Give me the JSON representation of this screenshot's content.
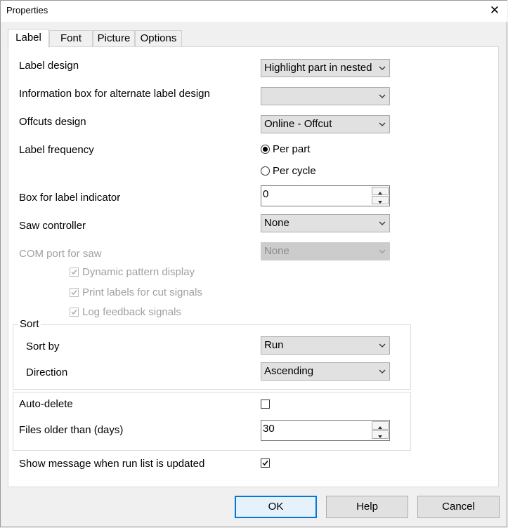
{
  "window": {
    "title": "Properties",
    "close_glyph": "✕"
  },
  "tabs": [
    {
      "label": "Label",
      "active": true
    },
    {
      "label": "Font",
      "active": false
    },
    {
      "label": "Picture",
      "active": false
    },
    {
      "label": "Options",
      "active": false
    }
  ],
  "fields": {
    "label_design": {
      "label": "Label design",
      "value": "Highlight part in nested"
    },
    "info_box": {
      "label": "Information box for alternate label design",
      "value": ""
    },
    "offcuts_design": {
      "label": "Offcuts design",
      "value": "Online - Offcut"
    },
    "label_frequency": {
      "label": "Label frequency",
      "option_part": "Per part",
      "option_cycle": "Per cycle",
      "selected": "Per part"
    },
    "box_indicator": {
      "label": "Box for label indicator",
      "value": "0"
    },
    "saw_controller": {
      "label": "Saw controller",
      "value": "None"
    },
    "com_port": {
      "label": "COM port for saw",
      "value": "None",
      "disabled": true
    },
    "dynamic_pattern": {
      "label": "Dynamic pattern display",
      "checked": true,
      "disabled": true
    },
    "print_labels": {
      "label": "Print labels for cut signals",
      "checked": true,
      "disabled": true
    },
    "log_feedback": {
      "label": "Log feedback signals",
      "checked": true,
      "disabled": true
    }
  },
  "sort": {
    "group_label": "Sort",
    "sort_by": {
      "label": "Sort by",
      "value": "Run"
    },
    "direction": {
      "label": "Direction",
      "value": "Ascending"
    }
  },
  "auto_delete": {
    "label": "Auto-delete",
    "checked": false,
    "files_older": {
      "label": "Files older than (days)",
      "value": "30"
    }
  },
  "show_message": {
    "label": "Show message when run list is updated",
    "checked": true
  },
  "buttons": {
    "ok": "OK",
    "help": "Help",
    "cancel": "Cancel"
  },
  "colors": {
    "accent": "#0078d7",
    "disabled_text": "#a0a0a0"
  }
}
